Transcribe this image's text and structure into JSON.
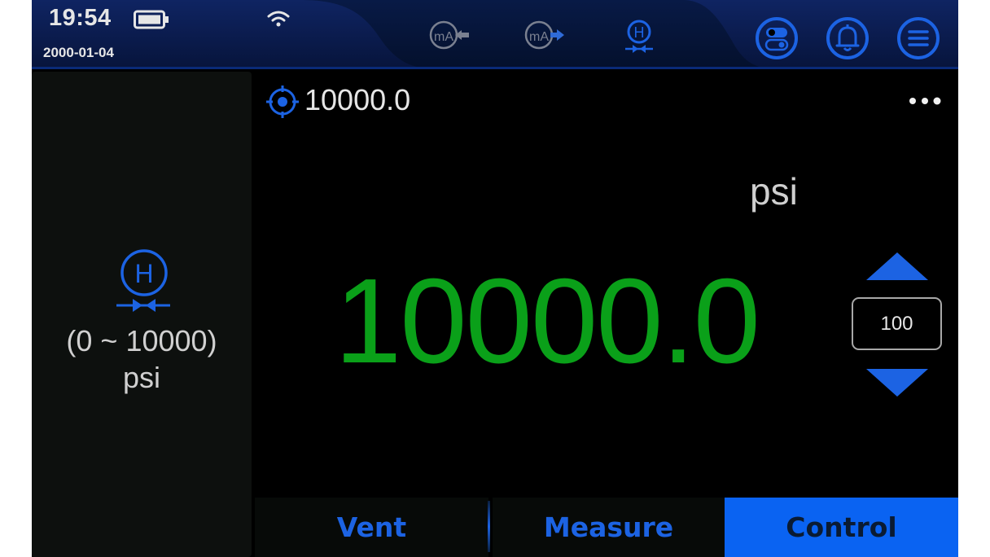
{
  "status_bar": {
    "time": "19:54",
    "date": "2000-01-04",
    "battery_icon": "battery-icon",
    "wifi_icon": "wifi-icon",
    "modes": [
      {
        "icon": "ma-input-icon",
        "label": "mA",
        "active": false
      },
      {
        "icon": "ma-output-icon",
        "label": "mA",
        "active": false
      },
      {
        "icon": "hydraulic-pressure-icon",
        "label": "H",
        "active": true
      }
    ],
    "buttons": [
      {
        "icon": "toggle-settings-icon"
      },
      {
        "icon": "bell-icon"
      },
      {
        "icon": "menu-icon"
      }
    ]
  },
  "left_panel": {
    "icon": "hydraulic-pressure-icon",
    "icon_label": "H",
    "range": "(0 ~ 10000)",
    "unit": "psi"
  },
  "main": {
    "target_icon": "target-icon",
    "setpoint": "10000.0",
    "more_icon": "more-icon",
    "unit": "psi",
    "reading": "10000.0",
    "step_value": "100"
  },
  "tabs": {
    "vent": "Vent",
    "measure": "Measure",
    "control": "Control",
    "active": "Control"
  },
  "colors": {
    "accent": "#0a63f2",
    "reading": "#0aa019",
    "icon_blue": "#1c63e3",
    "header_dark": "#0b1d52"
  }
}
